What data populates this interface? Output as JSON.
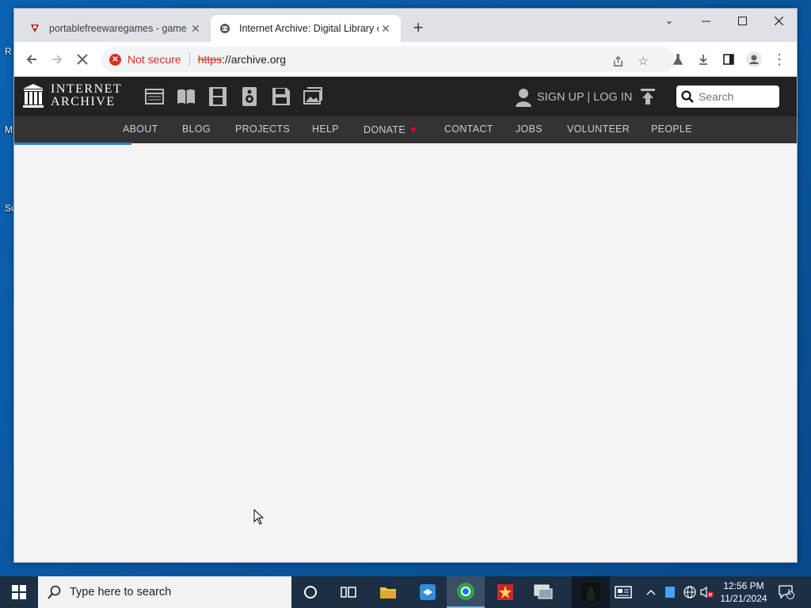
{
  "desktop": {
    "labels": [
      "R",
      "M",
      "Su"
    ]
  },
  "tabs": [
    {
      "title": "portablefreewaregames - game",
      "icon": "game-favicon",
      "active": false
    },
    {
      "title": "Internet Archive: Digital Library of",
      "icon": "archive-favicon",
      "active": true
    }
  ],
  "toolbar": {
    "security_label": "Not secure",
    "url_scheme": "https",
    "url_rest": "://archive.org"
  },
  "ia": {
    "logo_line1": "INTERNET",
    "logo_line2": "ARCHIVE",
    "media_icons": [
      "web-icon",
      "texts-icon",
      "video-icon",
      "audio-icon",
      "software-icon",
      "images-icon"
    ],
    "signin_label": "SIGN UP | LOG IN",
    "search_placeholder": "Search",
    "nav": [
      "ABOUT",
      "BLOG",
      "PROJECTS",
      "HELP",
      "DONATE",
      "CONTACT",
      "JOBS",
      "VOLUNTEER",
      "PEOPLE"
    ],
    "load_progress": 0.15
  },
  "taskbar": {
    "search_placeholder": "Type here to search",
    "time": "12:56 PM",
    "date": "11/21/2024",
    "notification_count": "1"
  },
  "colors": {
    "ia_bar": "#222222",
    "ia_nav": "#333333",
    "insecure": "#d93025",
    "donate_heart": "#e4002b"
  }
}
